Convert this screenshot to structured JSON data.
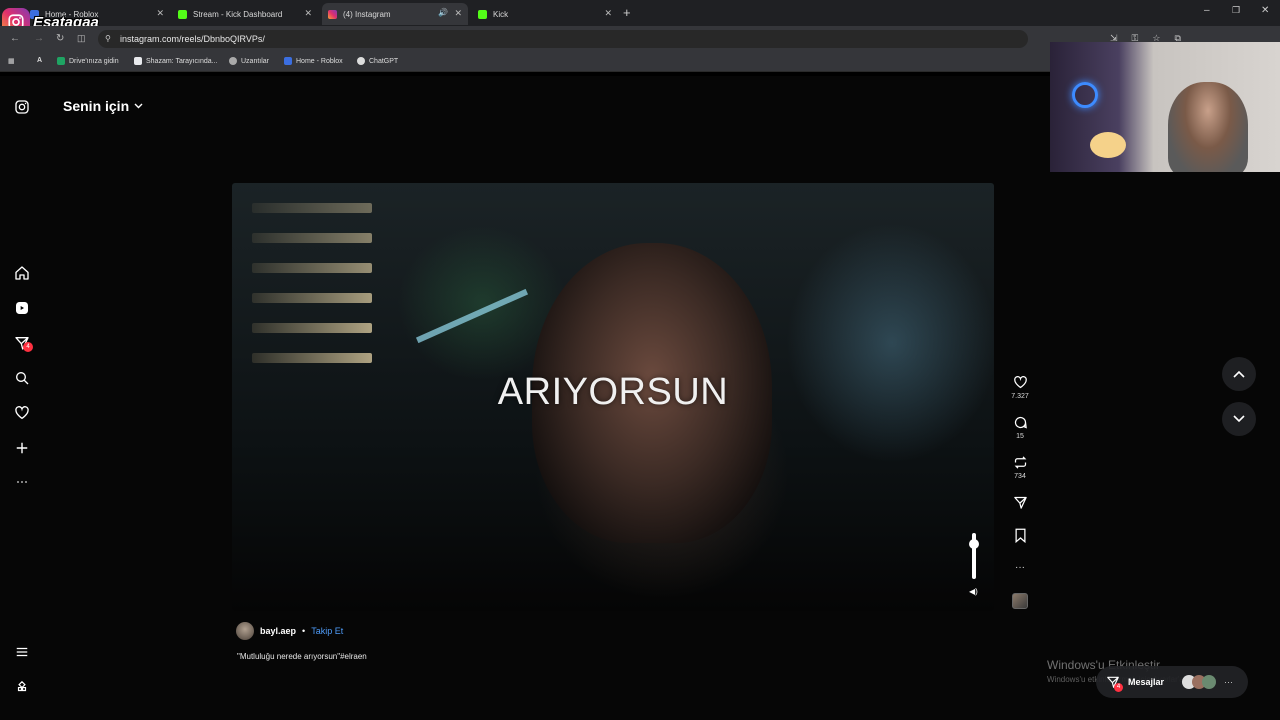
{
  "browser": {
    "tabs": [
      {
        "title": "Home - Roblox"
      },
      {
        "title": "Stream - Kick Dashboard"
      },
      {
        "title": "(4) Instagram"
      },
      {
        "title": "Kick"
      }
    ],
    "url": "instagram.com/reels/DbnboQIRVPs/",
    "bookmarks": [
      "Drive'ınıza gidin",
      "Shazam: Tarayıcında...",
      "Uzantılar",
      "Home - Roblox",
      "ChatGPT"
    ]
  },
  "overlay": {
    "streamer_name": "Esatagaa"
  },
  "header": {
    "feed_label": "Senin için"
  },
  "sidebar": {
    "notification_badge": "4"
  },
  "reel": {
    "caption_text": "ARIYORSUN",
    "author": "bayl.aep",
    "separator": "•",
    "follow_label": "Takip Et",
    "description": "\"Mutluluğu nerede arıyorsun\"#elraen",
    "likes": "7.327",
    "comments": "15",
    "reposts": "734",
    "more": "···"
  },
  "messages": {
    "label": "Mesajlar",
    "badge": "4"
  },
  "watermark": {
    "line1": "Windows'u Etkinleştir",
    "line2": "Windows'u etkinleştirmek için Ayarlar'a gidin."
  },
  "colors": {
    "accent": "#4f9cf9",
    "badge": "#ff3040",
    "kick": "#53fc18"
  }
}
